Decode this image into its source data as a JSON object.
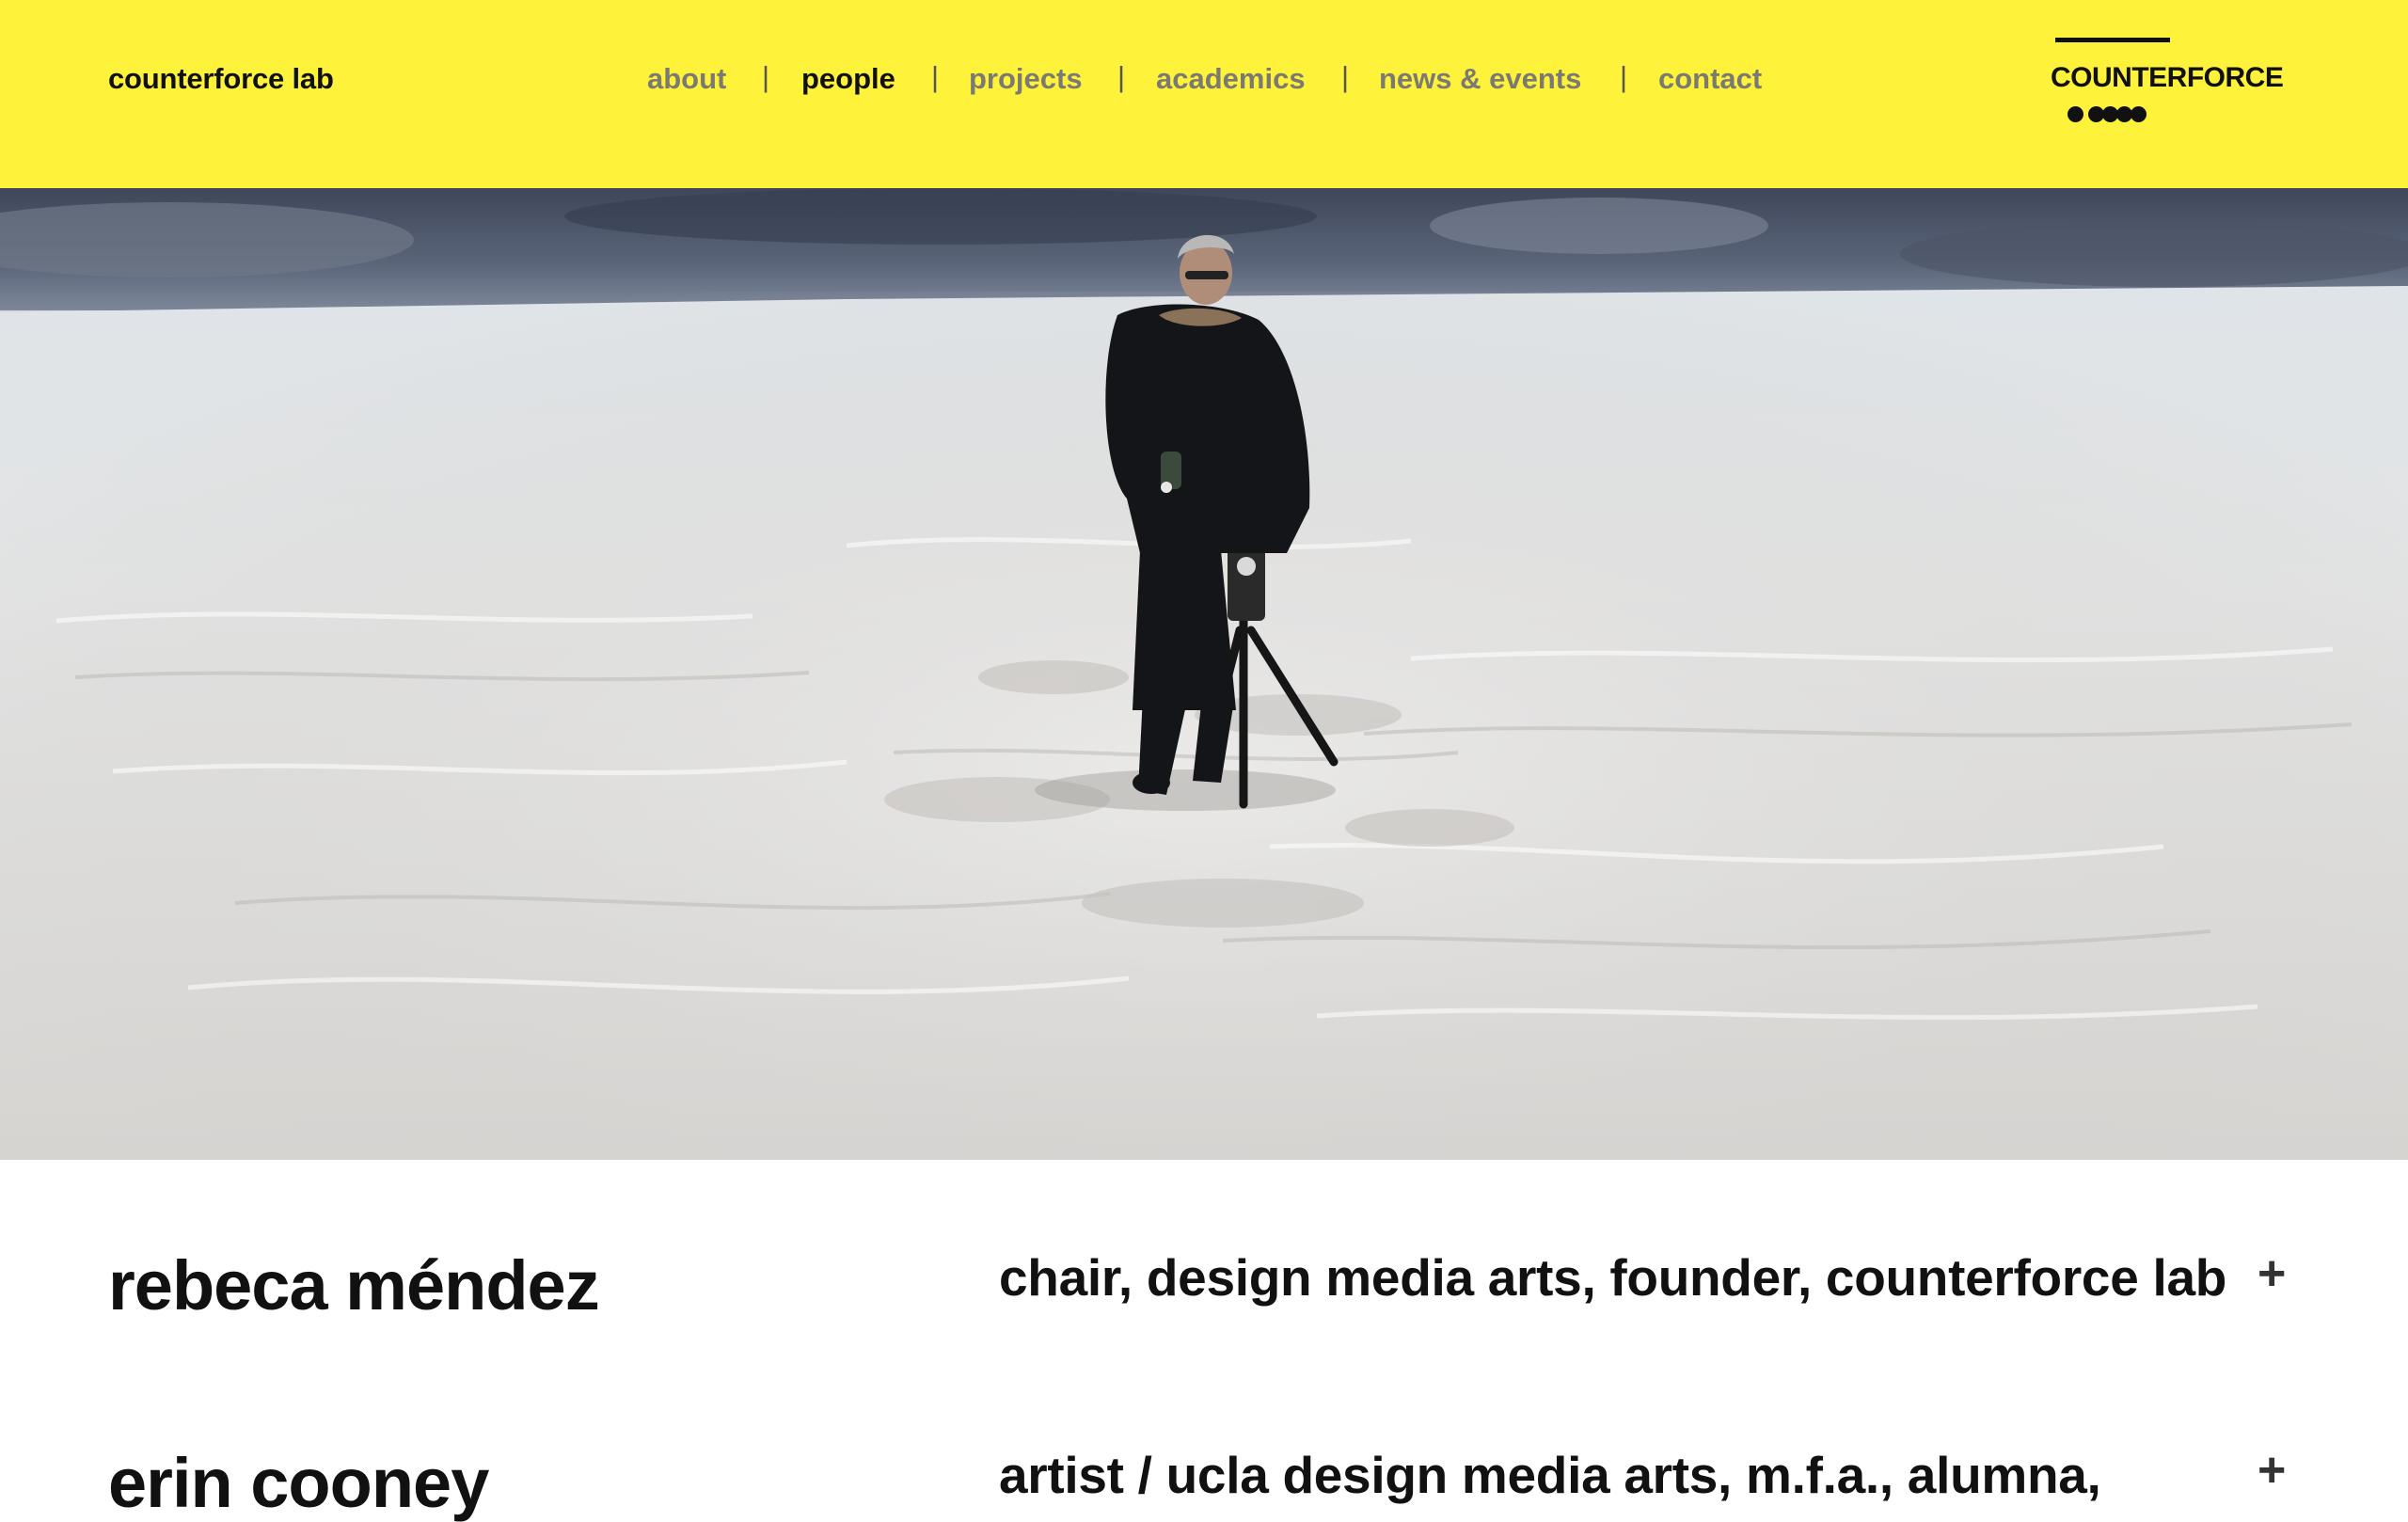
{
  "header": {
    "site_name": "counterforce lab",
    "nav": [
      {
        "label": "about"
      },
      {
        "label": "people"
      },
      {
        "label": "projects"
      },
      {
        "label": "academics"
      },
      {
        "label": "news & events"
      },
      {
        "label": "contact"
      }
    ],
    "nav_separator": "|",
    "active_nav": "people",
    "logo_text": "COUNTERFORCE",
    "background_color": "#fff23a"
  },
  "hero": {
    "image": "photo: person in dark parka standing with a camera on a tripod on a snowfield under a stormy sky"
  },
  "people": [
    {
      "name": "rebeca méndez",
      "role": "chair, design media arts, founder, counterforce lab",
      "expand_icon": "+"
    },
    {
      "name": "erin cooney",
      "role": "artist / ucla design media arts, m.f.a., alumna,",
      "expand_icon": "+"
    }
  ]
}
